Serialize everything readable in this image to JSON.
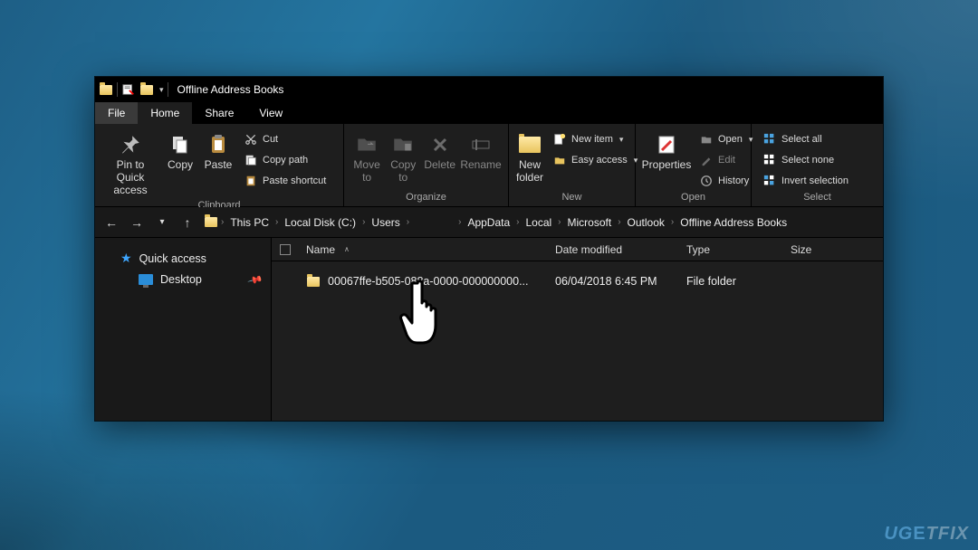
{
  "titlebar": {
    "title": "Offline Address Books"
  },
  "tabs": {
    "file": "File",
    "home": "Home",
    "share": "Share",
    "view": "View"
  },
  "ribbon": {
    "clipboard": {
      "pin": "Pin to Quick access",
      "copy": "Copy",
      "paste": "Paste",
      "cut": "Cut",
      "copy_path": "Copy path",
      "paste_shortcut": "Paste shortcut",
      "label": "Clipboard"
    },
    "organize": {
      "move_to": "Move to",
      "copy_to": "Copy to",
      "delete": "Delete",
      "rename": "Rename",
      "label": "Organize"
    },
    "new": {
      "new_folder": "New folder",
      "new_item": "New item",
      "easy_access": "Easy access",
      "label": "New"
    },
    "open": {
      "properties": "Properties",
      "open": "Open",
      "edit": "Edit",
      "history": "History",
      "label": "Open"
    },
    "select": {
      "select_all": "Select all",
      "select_none": "Select none",
      "invert": "Invert selection",
      "label": "Select"
    }
  },
  "breadcrumbs": {
    "items": [
      "This PC",
      "Local Disk (C:)",
      "Users",
      "",
      "AppData",
      "Local",
      "Microsoft",
      "Outlook",
      "Offline Address Books"
    ]
  },
  "sidebar": {
    "quick_access": "Quick access",
    "desktop": "Desktop"
  },
  "columns": {
    "name": "Name",
    "date": "Date modified",
    "type": "Type",
    "size": "Size"
  },
  "rows": [
    {
      "name": "00067ffe-b505-088a-0000-000000000...",
      "date": "06/04/2018 6:45 PM",
      "type": "File folder",
      "size": ""
    }
  ],
  "watermark": {
    "brand": "UG",
    "accent": "E",
    "rest": "TFIX"
  }
}
